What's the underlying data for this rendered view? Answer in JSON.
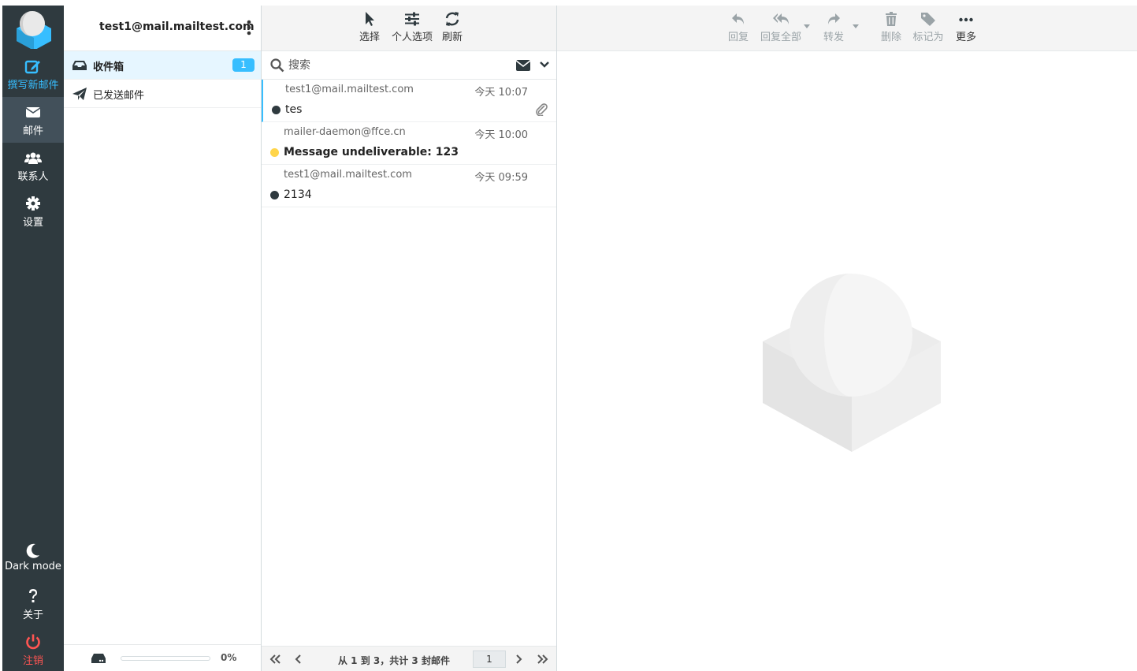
{
  "nav": {
    "compose": "撰写新邮件",
    "mail": "邮件",
    "contacts": "联系人",
    "settings": "设置",
    "dark_mode": "Dark mode",
    "about": "关于",
    "logout": "注销"
  },
  "account": {
    "email": "test1@mail.mailtest.com"
  },
  "folders": [
    {
      "name": "收件箱",
      "unread": "1"
    },
    {
      "name": "已发送邮件"
    }
  ],
  "quota": {
    "percent": 0,
    "text": "0%"
  },
  "list_toolbar": {
    "select": "选择",
    "options": "个人选项",
    "refresh": "刷新"
  },
  "search": {
    "placeholder": "搜索"
  },
  "messages": [
    {
      "from": "test1@mail.mailtest.com",
      "date": "今天 10:07",
      "subject": "tes",
      "unread": false,
      "flag_color": "#2f3a3f",
      "attachment": true
    },
    {
      "from": "mailer-daemon@ffce.cn",
      "date": "今天 10:00",
      "subject": "Message undeliverable: 123",
      "unread": true,
      "flag_color": "#ffd54a",
      "attachment": false
    },
    {
      "from": "test1@mail.mailtest.com",
      "date": "今天 09:59",
      "subject": "2134",
      "unread": false,
      "flag_color": "#2f3a3f",
      "attachment": false
    }
  ],
  "pagination": {
    "count_text": "从 1 到 3，共计 3 封邮件",
    "page": "1"
  },
  "content_toolbar": {
    "reply": "回复",
    "reply_all": "回复全部",
    "forward": "转发",
    "delete": "删除",
    "mark": "标记为",
    "more": "更多"
  },
  "colors": {
    "accent": "#37beff",
    "nav_bg": "#2f3a3f",
    "logout": "#ff5552"
  }
}
